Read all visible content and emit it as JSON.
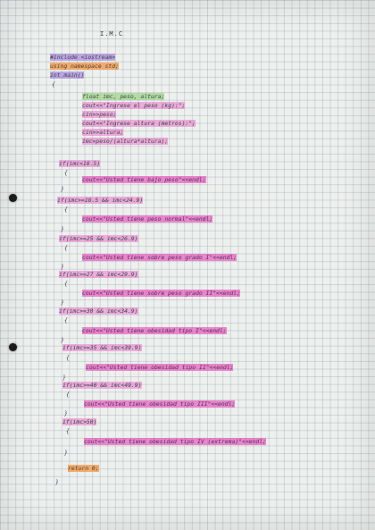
{
  "title": "I.M.C",
  "lines": [
    {
      "text": "#include <iostream>",
      "hl": "violet"
    },
    {
      "text": "using namespace std;",
      "hl": "orange"
    },
    {
      "text": "int main()",
      "hl": "violet"
    },
    {
      "text": "{",
      "hl": ""
    },
    {
      "text": "float imc, peso, altura;",
      "hl": "green"
    },
    {
      "text": "cout<<\"Ingrese el peso (kg):\";",
      "hl": "pink"
    },
    {
      "text": "cin>>peso;",
      "hl": "pink"
    },
    {
      "text": "cout<<\"Ingrese altura (metros):\";",
      "hl": "pink"
    },
    {
      "text": "cin>>altura;",
      "hl": "pink"
    },
    {
      "text": "imc=peso/(altura*altura);",
      "hl": "pink"
    },
    {
      "text": "if(imc<18.5)",
      "hl": "pink"
    },
    {
      "text": "{",
      "hl": ""
    },
    {
      "text": "cout<<\"Usted tiene bajo peso\"<<endl;",
      "hl": "pinkstr"
    },
    {
      "text": "}",
      "hl": ""
    },
    {
      "text": "if(imc>=18.5 && imc<24.9)",
      "hl": "pink"
    },
    {
      "text": "{",
      "hl": ""
    },
    {
      "text": "cout<<\"Usted tiene peso normal\"<<endl;",
      "hl": "pinkstr"
    },
    {
      "text": "}",
      "hl": ""
    },
    {
      "text": "if(imc>=25 && imc<26.9)",
      "hl": "pink"
    },
    {
      "text": "{",
      "hl": ""
    },
    {
      "text": "cout<<\"Usted tiene sobre peso grado I\"<<endl;",
      "hl": "pinkstr"
    },
    {
      "text": "}",
      "hl": ""
    },
    {
      "text": "if(imc>=27 && imc<29.9)",
      "hl": "pink"
    },
    {
      "text": "{",
      "hl": ""
    },
    {
      "text": "cout<<\"Usted tiene sobre peso grado II\"<<endl;",
      "hl": "pinkstr"
    },
    {
      "text": "}",
      "hl": ""
    },
    {
      "text": "if(imc>=30 && imc<34.9)",
      "hl": "pink"
    },
    {
      "text": "{",
      "hl": ""
    },
    {
      "text": "cout<<\"Usted tiene obesidad tipo I\"<<endl;",
      "hl": "pinkstr"
    },
    {
      "text": "}",
      "hl": ""
    },
    {
      "text": "if(imc>=35 && imc<39.9)",
      "hl": "pink"
    },
    {
      "text": "{",
      "hl": ""
    },
    {
      "text": "cout<<\"Usted tiene obesidad tipo II\"<<endl;",
      "hl": "pinkstr"
    },
    {
      "text": "}",
      "hl": ""
    },
    {
      "text": "if(imc>=40 && imc<49.9)",
      "hl": "pink"
    },
    {
      "text": "{",
      "hl": ""
    },
    {
      "text": "cout<<\"Usted tiene obesidad tipo III\"<<endl;",
      "hl": "pinkstr"
    },
    {
      "text": "}",
      "hl": ""
    },
    {
      "text": "if(imc>50)",
      "hl": "pink"
    },
    {
      "text": "{",
      "hl": ""
    },
    {
      "text": "cout<<\"Usted tiene obesidad tipo IV (extrema)\"<<endl;",
      "hl": "pinkstr"
    },
    {
      "text": "}",
      "hl": ""
    },
    {
      "text": "return 0;",
      "hl": "orange"
    },
    {
      "text": "}",
      "hl": ""
    }
  ]
}
